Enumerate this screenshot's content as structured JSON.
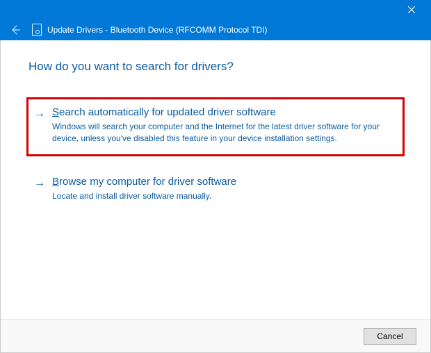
{
  "header": {
    "title": "Update Drivers - Bluetooth Device (RFCOMM Protocol TDI)"
  },
  "page": {
    "heading": "How do you want to search for drivers?"
  },
  "options": {
    "auto": {
      "mnemonic": "S",
      "title_rest": "earch automatically for updated driver software",
      "description": "Windows will search your computer and the Internet for the latest driver software for your device, unless you've disabled this feature in your device installation settings."
    },
    "browse": {
      "mnemonic": "B",
      "title_rest": "rowse my computer for driver software",
      "description": "Locate and install driver software manually."
    }
  },
  "footer": {
    "cancel_label": "Cancel"
  }
}
